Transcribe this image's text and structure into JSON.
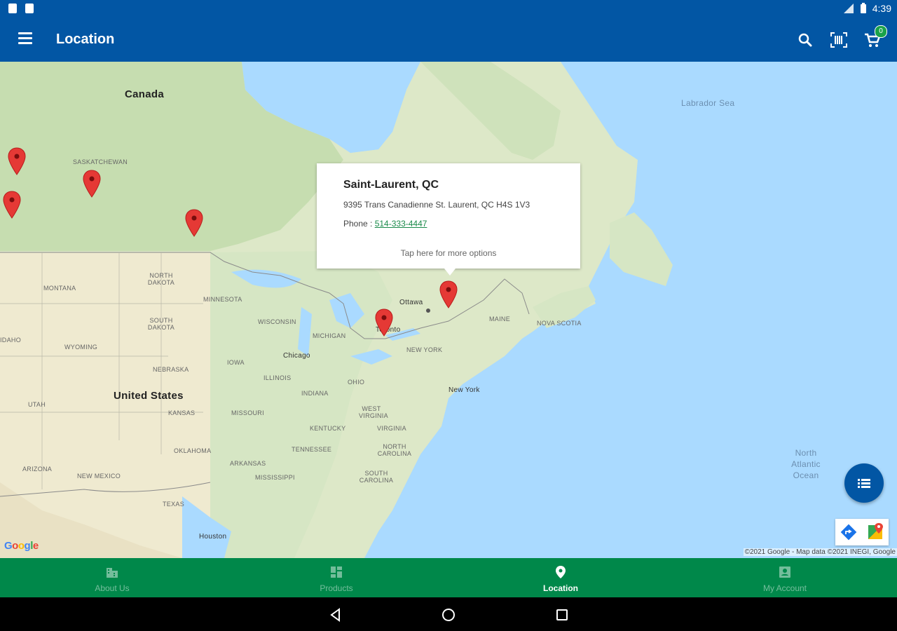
{
  "status_bar": {
    "time": "4:39"
  },
  "app_bar": {
    "title": "Location",
    "cart_count": "0"
  },
  "map": {
    "labels": {
      "canada": "Canada",
      "united_states": "United States",
      "labrador_sea": "Labrador Sea",
      "north_atlantic": "North Atlantic Ocean",
      "saskatchewan": "SASKATCHEWAN",
      "north_dakota": "NORTH DAKOTA",
      "south_dakota": "SOUTH DAKOTA",
      "montana": "MONTANA",
      "wyoming": "WYOMING",
      "nebraska": "NEBRASKA",
      "kansas": "KANSAS",
      "oklahoma": "OKLAHOMA",
      "texas": "TEXAS",
      "new_mexico": "NEW MEXICO",
      "arizona": "ARIZONA",
      "utah": "UTAH",
      "idaho": "IDAHO",
      "minnesota": "MINNESOTA",
      "wisconsin": "WISCONSIN",
      "iowa": "IOWA",
      "illinois": "ILLINOIS",
      "michigan": "MICHIGAN",
      "missouri": "MISSOURI",
      "arkansas": "ARKANSAS",
      "mississippi": "MISSISSIPPI",
      "indiana": "INDIANA",
      "ohio": "OHIO",
      "kentucky": "KENTUCKY",
      "tennessee": "TENNESSEE",
      "west_virginia": "WEST VIRGINIA",
      "virginia": "VIRGINIA",
      "north_carolina": "NORTH CAROLINA",
      "south_carolina": "SOUTH CAROLINA",
      "new_york_state": "NEW YORK",
      "maine": "MAINE",
      "nova_scotia": "NOVA SCOTIA",
      "ottawa": "Ottawa",
      "toronto": "Toronto",
      "chicago": "Chicago",
      "new_york": "New York",
      "houston": "Houston"
    },
    "popup": {
      "title": "Saint-Laurent, QC",
      "address": "9395 Trans Canadienne St. Laurent, QC H4S 1V3",
      "phone_label": "Phone : ",
      "phone": "514-333-4447",
      "more": "Tap here for more options"
    },
    "google_logo": "Google",
    "attribution": "©2021 Google - Map data ©2021 INEGI, Google",
    "pin_color": "#e53935"
  },
  "bottom_nav": {
    "items": [
      {
        "label": "About Us",
        "icon": "building-icon"
      },
      {
        "label": "Products",
        "icon": "dashboard-icon"
      },
      {
        "label": "Location",
        "icon": "location-pin-icon"
      },
      {
        "label": "My Account",
        "icon": "account-box-icon"
      }
    ]
  }
}
